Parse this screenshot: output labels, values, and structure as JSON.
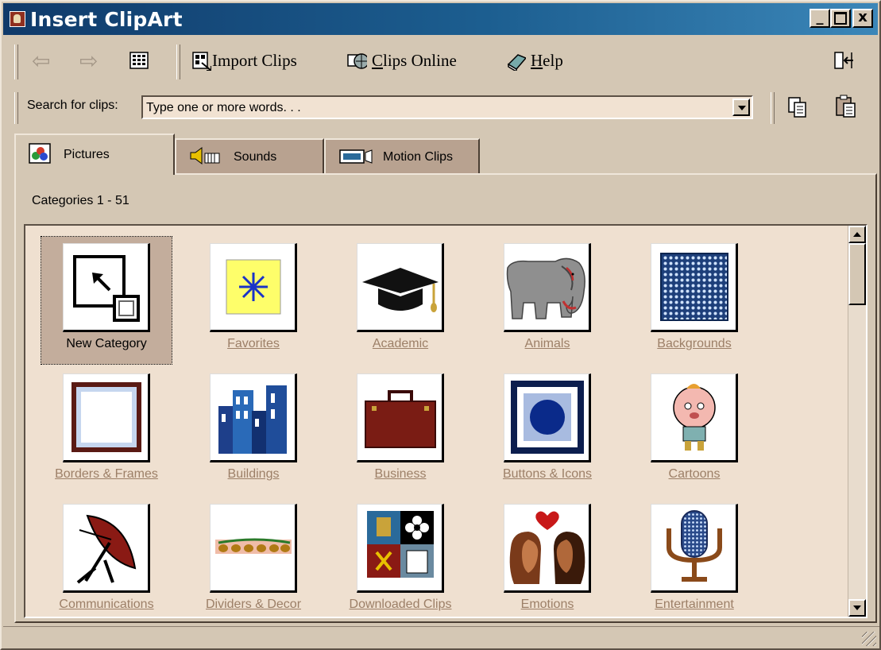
{
  "window": {
    "title": "Insert ClipArt"
  },
  "title_buttons": {
    "minimize": "_",
    "maximize": "□",
    "close": "x"
  },
  "toolbar": {
    "back_icon": "back-arrow-icon",
    "forward_icon": "forward-arrow-icon",
    "view_icon": "grid-view-icon",
    "import_clips_label": "Import Clips",
    "import_clips_accel": "I",
    "clips_online_label": "lips Online",
    "clips_online_accel": "C",
    "help_label": "elp",
    "help_accel": "H",
    "restore_icon": "change-window-size-icon"
  },
  "search": {
    "label": "Search for clips:",
    "placeholder": "Type one or more words. . ."
  },
  "tabs": [
    {
      "label": "Pictures",
      "icon": "pictures-icon"
    },
    {
      "label": "Sounds",
      "icon": "sounds-icon"
    },
    {
      "label": "Motion Clips",
      "icon": "motion-clips-icon"
    }
  ],
  "categories": {
    "count_label": "Categories 1 - 51",
    "items": [
      {
        "label": "New Category"
      },
      {
        "label": "Favorites"
      },
      {
        "label": "Academic"
      },
      {
        "label": "Animals"
      },
      {
        "label": "Backgrounds"
      },
      {
        "label": "Borders & Frames"
      },
      {
        "label": "Buildings"
      },
      {
        "label": "Business"
      },
      {
        "label": "Buttons & Icons"
      },
      {
        "label": "Cartoons"
      },
      {
        "label": "Communications"
      },
      {
        "label": "Dividers & Decor"
      },
      {
        "label": "Downloaded Clips"
      },
      {
        "label": "Emotions"
      },
      {
        "label": "Entertainment"
      }
    ]
  },
  "colors": {
    "title_gradient_start": "#103a6a",
    "title_gradient_end": "#3b86b8",
    "window_face": "#d4c7b4",
    "gallery_bg": "#efe0d0",
    "link_text": "#9c7f67"
  }
}
